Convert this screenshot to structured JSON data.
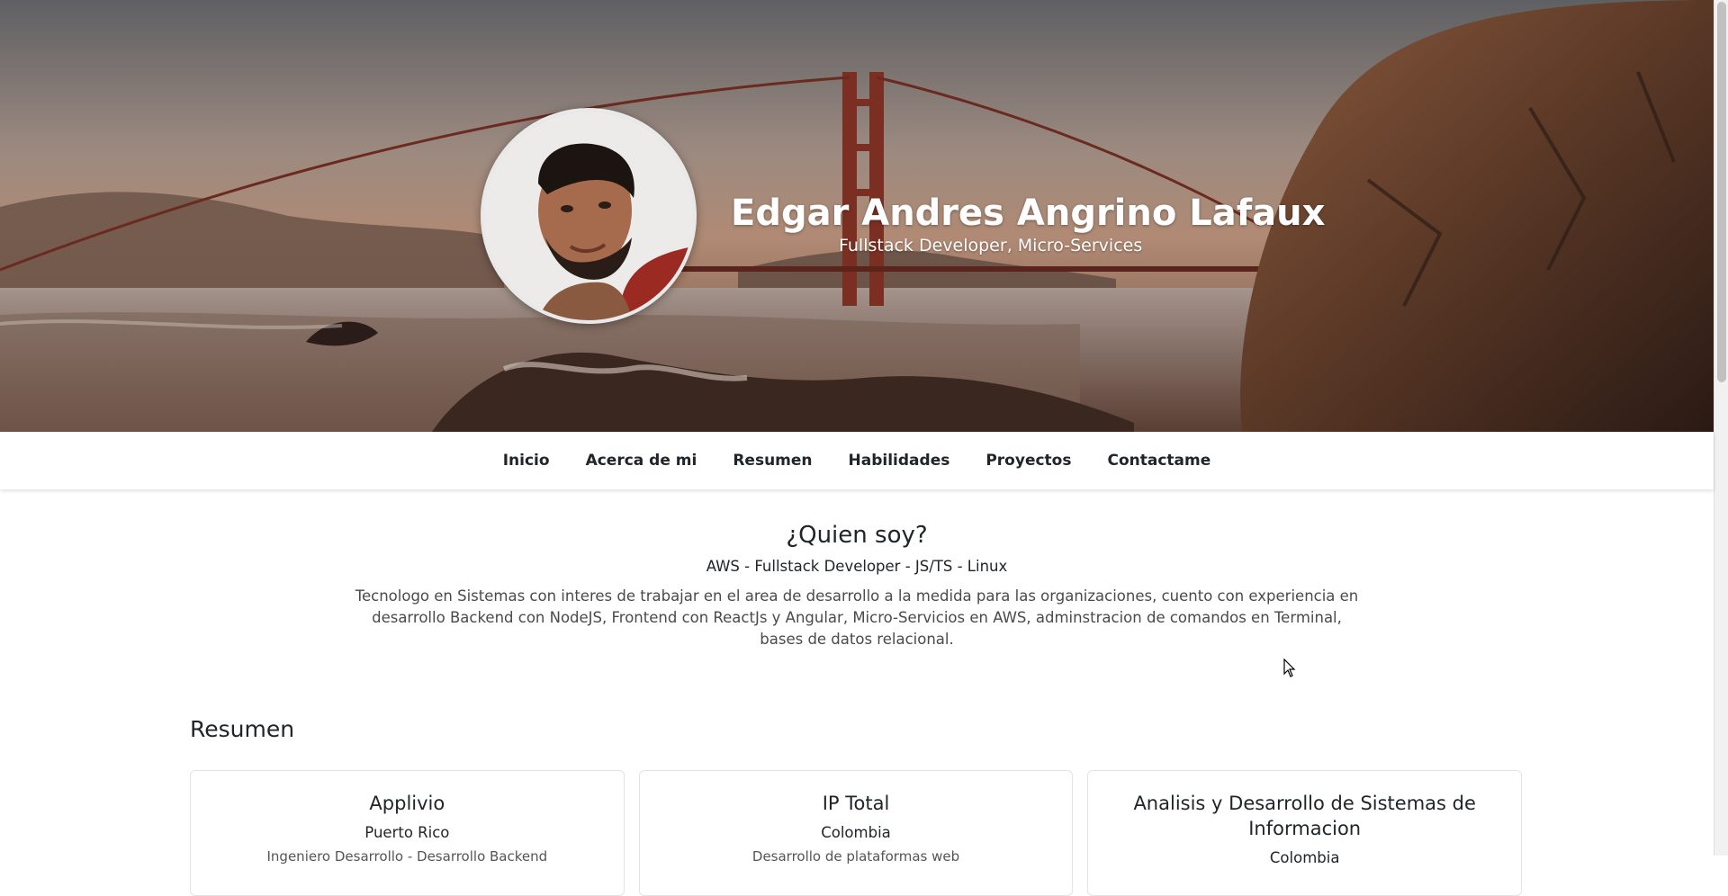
{
  "hero": {
    "name": "Edgar Andres Angrino Lafaux",
    "subtitle": "Fullstack Developer, Micro-Services"
  },
  "nav": {
    "items": [
      "Inicio",
      "Acerca de mi",
      "Resumen",
      "Habilidades",
      "Proyectos",
      "Contactame"
    ]
  },
  "about": {
    "title": "¿Quien soy?",
    "tagline": "AWS - Fullstack Developer - JS/TS - Linux",
    "description": "Tecnologo en Sistemas con interes de trabajar en el area de desarrollo a la medida para las organizaciones, cuento con experiencia en desarrollo Backend con NodeJS, Frontend con ReactJs y Angular, Micro-Servicios en AWS, adminstracion de comandos en Terminal, bases de datos relacional."
  },
  "resumen": {
    "title": "Resumen",
    "cards": [
      {
        "title": "Applivio",
        "place": "Puerto Rico",
        "body": "Ingeniero Desarrollo - Desarrollo Backend"
      },
      {
        "title": "IP Total",
        "place": "Colombia",
        "body": "Desarrollo de plataformas web"
      },
      {
        "title": "Analisis y Desarrollo de Sistemas de Informacion",
        "place": "Colombia",
        "body": ""
      }
    ]
  },
  "colors": {
    "text": "#212529",
    "nav_bg": "#ffffff",
    "hero_text": "#ffffff"
  }
}
